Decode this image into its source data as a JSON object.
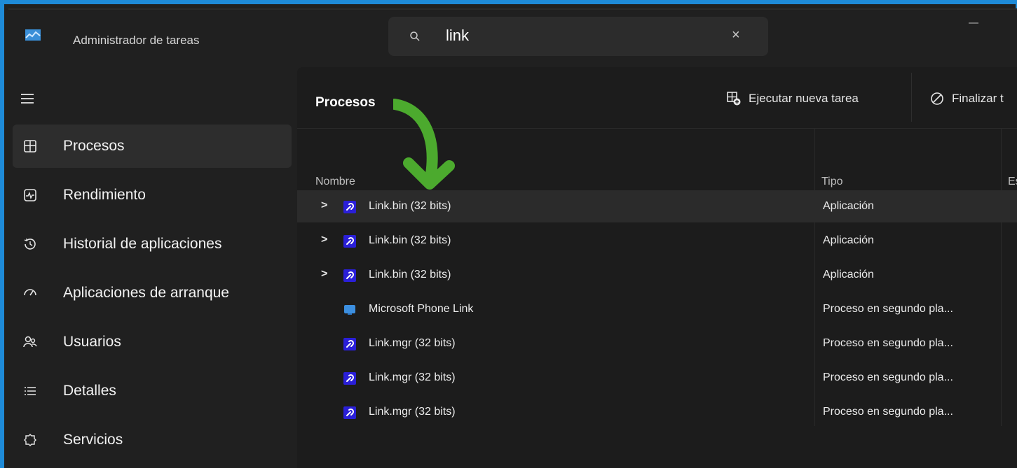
{
  "app": {
    "title": "Administrador de tareas"
  },
  "search": {
    "query": "link",
    "clear_glyph": "×"
  },
  "sidebar": {
    "items": [
      {
        "label": "Procesos",
        "icon": "processes-icon",
        "active": true
      },
      {
        "label": "Rendimiento",
        "icon": "performance-icon",
        "active": false
      },
      {
        "label": "Historial de aplicaciones",
        "icon": "history-icon",
        "active": false
      },
      {
        "label": "Aplicaciones de arranque",
        "icon": "startup-icon",
        "active": false
      },
      {
        "label": "Usuarios",
        "icon": "users-icon",
        "active": false
      },
      {
        "label": "Detalles",
        "icon": "details-icon",
        "active": false
      },
      {
        "label": "Servicios",
        "icon": "services-icon",
        "active": false
      }
    ]
  },
  "main": {
    "title": "Procesos",
    "run_task": "Ejecutar nueva tarea",
    "end_task": "Finalizar t",
    "columns": {
      "name": "Nombre",
      "type": "Tipo",
      "status": "Es"
    },
    "rows": [
      {
        "name": "Link.bin (32 bits)",
        "type": "Aplicación",
        "expand": ">",
        "icon": "link-app-icon"
      },
      {
        "name": "Link.bin (32 bits)",
        "type": "Aplicación",
        "expand": ">",
        "icon": "link-app-icon"
      },
      {
        "name": "Link.bin (32 bits)",
        "type": "Aplicación",
        "expand": ">",
        "icon": "link-app-icon"
      },
      {
        "name": "Microsoft Phone Link",
        "type": "Proceso en segundo pla...",
        "expand": "",
        "icon": "phone-link-icon"
      },
      {
        "name": "Link.mgr (32 bits)",
        "type": "Proceso en segundo pla...",
        "expand": "",
        "icon": "link-app-icon"
      },
      {
        "name": "Link.mgr (32 bits)",
        "type": "Proceso en segundo pla...",
        "expand": "",
        "icon": "link-app-icon"
      },
      {
        "name": "Link.mgr (32 bits)",
        "type": "Proceso en segundo pla...",
        "expand": "",
        "icon": "link-app-icon"
      }
    ]
  },
  "colors": {
    "accent_border": "#1e8bd8",
    "arrow": "#4caa2e",
    "background": "#202020"
  }
}
